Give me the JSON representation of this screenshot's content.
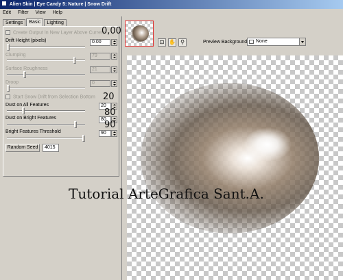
{
  "window": {
    "title": "Alien Skin | Eye Candy 5: Nature | Snow Drift"
  },
  "menu": [
    "Edit",
    "Filter",
    "View",
    "Help"
  ],
  "tabs": [
    "Settings",
    "Basic",
    "Lighting"
  ],
  "controls": {
    "create_output": "Create Output In New Layer Above Current",
    "drift_height_label": "Drift Height (pixels)",
    "drift_height_value": "0.00",
    "clumping_label": "Clumping",
    "clumping_value": "79",
    "surface_roughness_label": "Surface Roughness",
    "surface_roughness_value": "21",
    "droop_label": "Droop",
    "droop_value": "0",
    "start_snow_drift": "Start Snow Drift from Selection Bottom",
    "dust_all_label": "Dust on All Features",
    "dust_all_value": "20",
    "dust_bright_label": "Dust on Bright Features",
    "dust_bright_value": "80",
    "bright_threshold_label": "Bright Features Threshold",
    "bright_threshold_value": "90",
    "random_seed_label": "Random Seed",
    "random_seed_value": "4015"
  },
  "annotations": {
    "drift_height": "0,00",
    "dust_all": "20",
    "dust_bright": "80",
    "threshold": "90"
  },
  "preview": {
    "background_label": "Preview Background:",
    "background_value": "None"
  },
  "watermark": "Tutorial ArteGrafica Sant.A."
}
